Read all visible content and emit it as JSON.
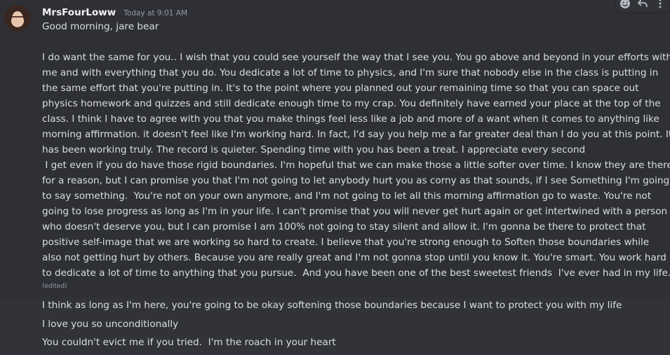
{
  "message": {
    "author": "MrsFourLoww",
    "timestamp": "Today at 9:01 AM",
    "greeting": "Good morning, jare bear",
    "lines": [
      "I do want the same for you.. I wish that you could see yourself the way that I see you. You go above and beyond in your efforts with",
      "me and with everything that you do. You dedicate a lot of time to physics, and I'm sure that nobody else in the class is putting in",
      "the same effort that you're putting in. It's to the point where you planned out your remaining time so that you can space out",
      "physics homework and quizzes and still dedicate enough time to my crap. You definitely have earned your place at the top of the",
      "class. I think I have to agree with you that you make things feel less like a job and more of a want when it comes to anything like",
      "morning affirmation. it doesn't feel like I'm working hard. In fact, I'd say you help me a far greater deal than I do you at this point. It",
      "has been working truly. The record is quieter. Spending time with you has been a treat. I appreciate every second",
      " I get even if you do have those rigid boundaries. I'm hopeful that we can make those a little softer over time. I know they are there",
      "for a reason, but I can promise you that I'm not going to let anybody hurt you as corny as that sounds, if I see Something I'm going",
      "to say something.  You're not on your own anymore, and I'm not going to let all this morning affirmation go to waste. You're not",
      "going to lose progress as long as I'm in your life. I can't promise that you will never get hurt again or get intertwined with a person",
      "who doesn't deserve you, but I can promise I am 100% not going to stay silent and allow it. I'm gonna be there to protect that",
      "positive self-image that we are working so hard to create. I believe that you're strong enough to Soften those boundaries while",
      "also not getting hurt by others. Because you are really great and I'm not gonna stop until you know it. You're smart. You work hard",
      "to dedicate a lot of time to anything that you pursue.  And you have been one of the best sweetest friends  I've ever had in my life."
    ],
    "edited_label": "(edited)"
  },
  "followups": [
    "I think as long as I'm here, you're going to be okay softening those boundaries because I want to protect you with my life",
    "I love you so unconditionally",
    "You couldn't evict me if you tried.  I'm the roach in your heart"
  ],
  "toolbar": {
    "icons": [
      "add-reaction-icon",
      "reply-icon",
      "more-icon"
    ]
  },
  "colors": {
    "background": "#313338",
    "hover_background": "#2e3035",
    "text": "#dbdee1",
    "username": "#f2f3f5",
    "muted": "#949ba4"
  }
}
